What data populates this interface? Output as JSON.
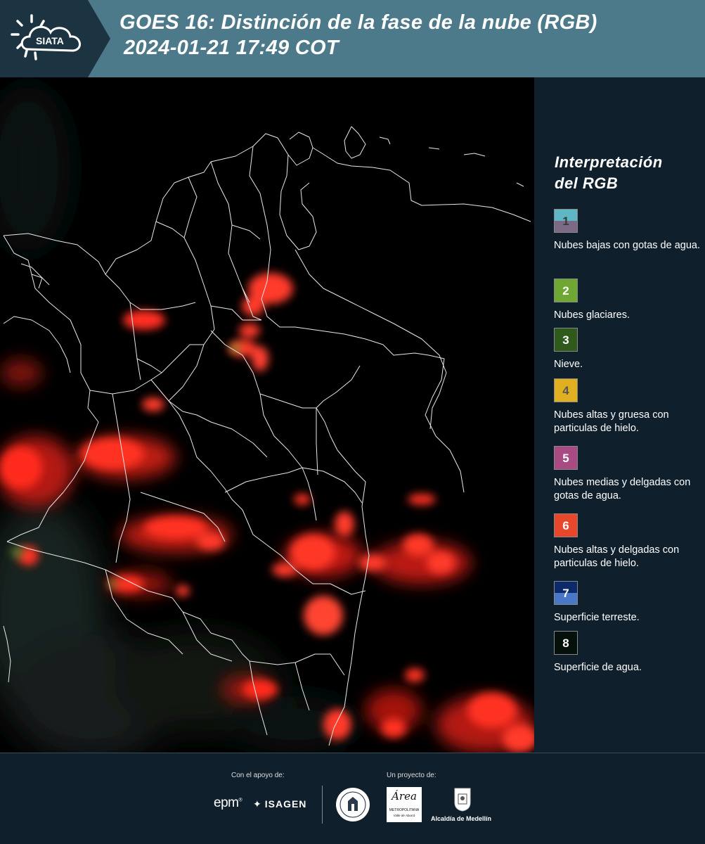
{
  "header": {
    "logo_text": "SIATA",
    "title_line1": "GOES 16: Distinción de la fase de la nube (RGB)",
    "title_line2": "2024-01-21 17:49 COT"
  },
  "legend": {
    "title_line1": "Interpretación",
    "title_line2": "del RGB",
    "items": [
      {
        "number": "1",
        "top_color": "#5fb6c4",
        "bottom_color": "#7a6a86",
        "num_color": "#3a3a3a",
        "label": "Nubes bajas con gotas de agua."
      },
      {
        "number": "2",
        "top_color": "#6ea832",
        "bottom_color": "#6ea832",
        "num_color": "#ffffff",
        "label": "Nubes glaciares."
      },
      {
        "number": "3",
        "top_color": "#2f5a1c",
        "bottom_color": "#2f5a1c",
        "num_color": "#ffffff",
        "label": "Nieve."
      },
      {
        "number": "4",
        "top_color": "#e0b020",
        "bottom_color": "#e0b020",
        "num_color": "#555555",
        "label": "Nubes altas y gruesa con particulas de hielo."
      },
      {
        "number": "5",
        "top_color": "#a94a82",
        "bottom_color": "#a94a82",
        "num_color": "#ffffff",
        "label": "Nubes medias y delgadas con gotas de agua."
      },
      {
        "number": "6",
        "top_color": "#e8472c",
        "bottom_color": "#e8472c",
        "num_color": "#ffffff",
        "label": "Nubes altas y delgadas con particulas de hielo."
      },
      {
        "number": "7",
        "top_color": "#0c2a6a",
        "bottom_color": "#4a78c8",
        "num_color": "#ffffff",
        "label": "Superficie terreste."
      },
      {
        "number": "8",
        "top_color": "#06100a",
        "bottom_color": "#06100a",
        "num_color": "#ffffff",
        "label": "Superficie de agua."
      }
    ]
  },
  "footer": {
    "support_label": "Con el apoyo de:",
    "project_label": "Un proyecto de:",
    "epm": "epm",
    "isagen": "ISAGEN",
    "area_name": "Área",
    "area_sub1": "METROPOLITANA",
    "area_sub2": "Valle de Aburrá",
    "alcaldia": "Alcaldía de Medellín"
  }
}
